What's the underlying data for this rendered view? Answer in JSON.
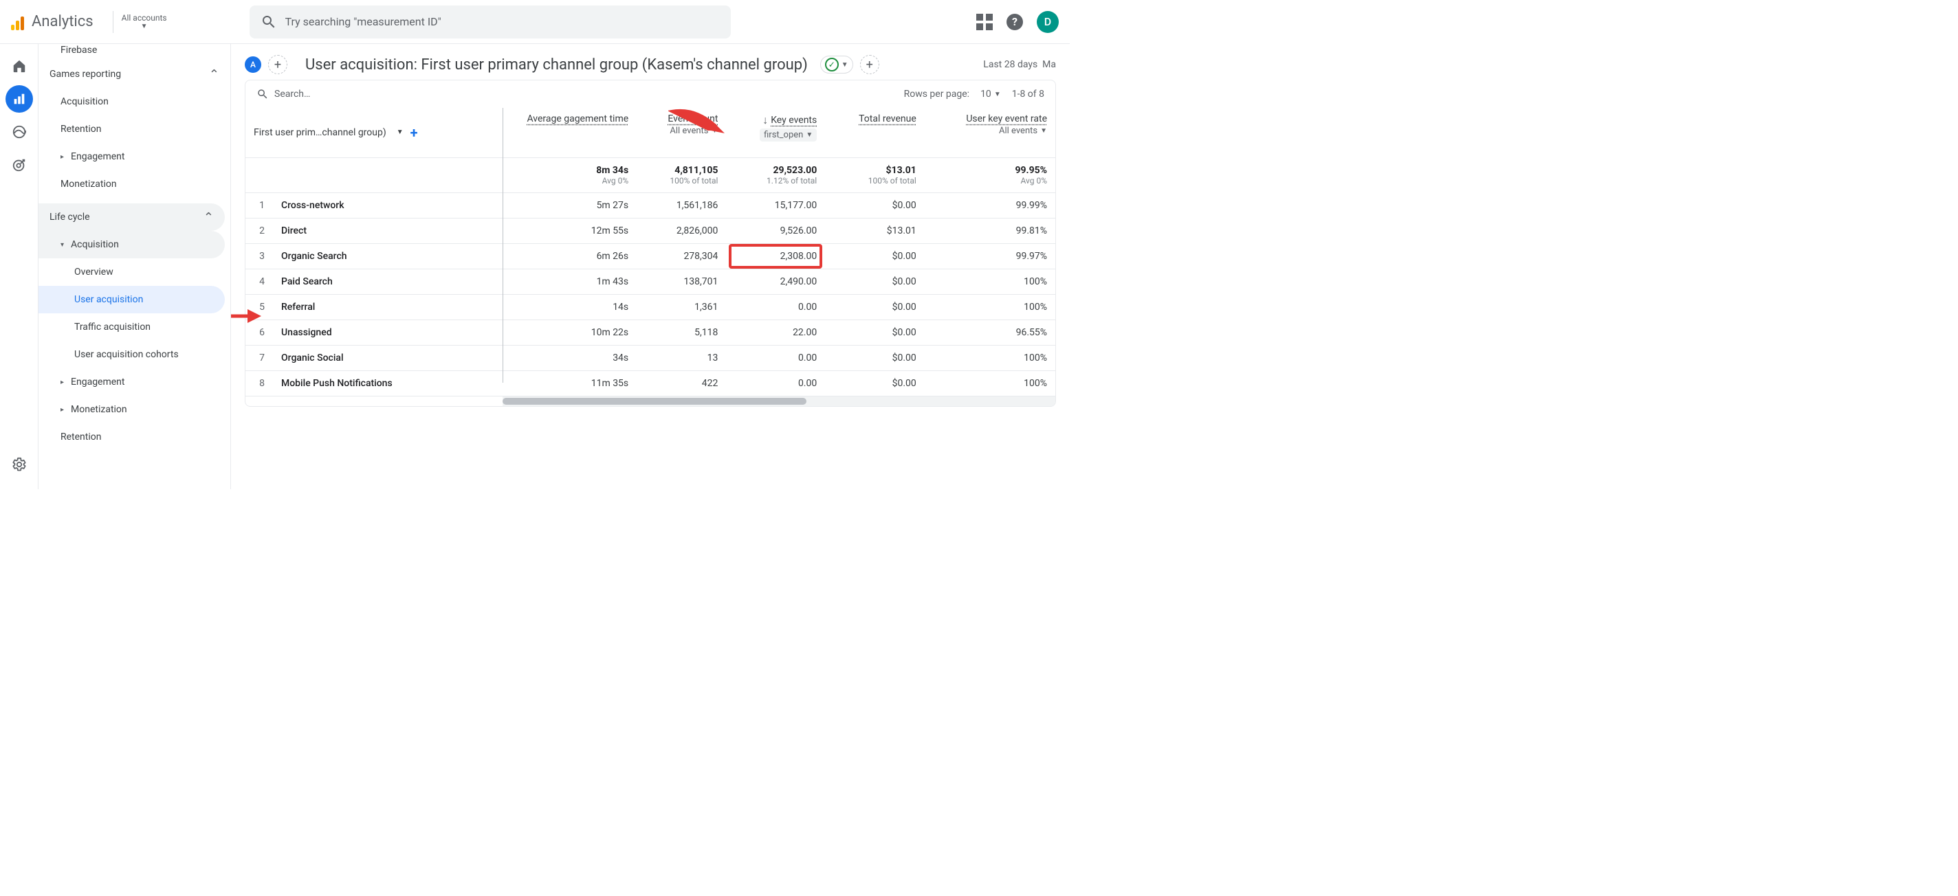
{
  "header": {
    "product": "Analytics",
    "account_selector": "All accounts",
    "search_placeholder": "Try searching \"measurement ID\"",
    "avatar_letter": "D"
  },
  "sidebar": {
    "cut_top": "Firebase",
    "group1": {
      "label": "Games reporting",
      "items": [
        "Acquisition",
        "Retention",
        "Engagement",
        "Monetization"
      ]
    },
    "group2": {
      "label": "Life cycle",
      "acq": {
        "label": "Acquisition",
        "children": [
          "Overview",
          "User acquisition",
          "Traffic acquisition",
          "User acquisition cohorts"
        ]
      },
      "others": [
        "Engagement",
        "Monetization",
        "Retention"
      ]
    },
    "selected": "User acquisition"
  },
  "page": {
    "badge": "A",
    "title": "User acquisition: First user primary channel group (Kasem's channel group)",
    "date_range_prefix": "Last 28 days",
    "date_range_suffix": "Ma"
  },
  "toolbar": {
    "search_placeholder": "Search…",
    "rows_label": "Rows per page:",
    "rows_value": "10",
    "pagination": "1-8 of 8"
  },
  "columns": {
    "dimension_label": "First user prim…channel group)",
    "c1": {
      "label": "Average gagement time"
    },
    "c2": {
      "label": "Event count",
      "sub": "All events"
    },
    "c3": {
      "label": "Key events",
      "sub": "first_open"
    },
    "c4": {
      "label": "Total revenue"
    },
    "c5": {
      "label": "User key event rate",
      "sub": "All events"
    }
  },
  "summary": {
    "c1": {
      "v": "8m 34s",
      "d": "Avg 0%"
    },
    "c2": {
      "v": "4,811,105",
      "d": "100% of total"
    },
    "c3": {
      "v": "29,523.00",
      "d": "1.12% of total"
    },
    "c4": {
      "v": "$13.01",
      "d": "100% of total"
    },
    "c5": {
      "v": "99.95%",
      "d": "Avg 0%"
    }
  },
  "rows": [
    {
      "i": 1,
      "dim": "Cross-network",
      "c1": "5m 27s",
      "c2": "1,561,186",
      "c3": "15,177.00",
      "c4": "$0.00",
      "c5": "99.99%"
    },
    {
      "i": 2,
      "dim": "Direct",
      "c1": "12m 55s",
      "c2": "2,826,000",
      "c3": "9,526.00",
      "c4": "$13.01",
      "c5": "99.81%"
    },
    {
      "i": 3,
      "dim": "Organic Search",
      "c1": "6m 26s",
      "c2": "278,304",
      "c3": "2,308.00",
      "c4": "$0.00",
      "c5": "99.97%",
      "hl": true
    },
    {
      "i": 4,
      "dim": "Paid Search",
      "c1": "1m 43s",
      "c2": "138,701",
      "c3": "2,490.00",
      "c4": "$0.00",
      "c5": "100%"
    },
    {
      "i": 5,
      "dim": "Referral",
      "c1": "14s",
      "c2": "1,361",
      "c3": "0.00",
      "c4": "$0.00",
      "c5": "100%"
    },
    {
      "i": 6,
      "dim": "Unassigned",
      "c1": "10m 22s",
      "c2": "5,118",
      "c3": "22.00",
      "c4": "$0.00",
      "c5": "96.55%"
    },
    {
      "i": 7,
      "dim": "Organic Social",
      "c1": "34s",
      "c2": "13",
      "c3": "0.00",
      "c4": "$0.00",
      "c5": "100%"
    },
    {
      "i": 8,
      "dim": "Mobile Push Notifications",
      "c1": "11m 35s",
      "c2": "422",
      "c3": "0.00",
      "c4": "$0.00",
      "c5": "100%"
    }
  ]
}
